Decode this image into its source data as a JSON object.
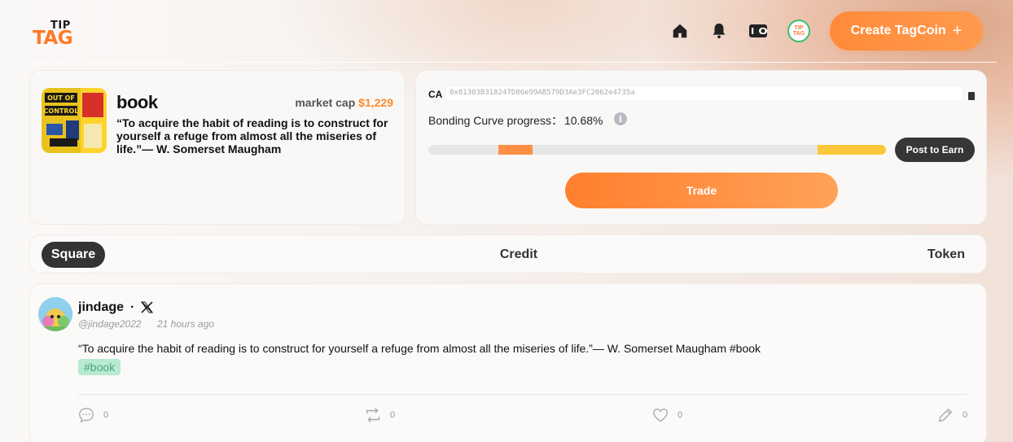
{
  "brand": {
    "logo_top": "TIP",
    "logo_bottom": "TAG"
  },
  "header": {
    "nav_icons": [
      "home-icon",
      "bell-icon",
      "wallet-icon",
      "profile-avatar"
    ],
    "avatar_text": "TIP TAG",
    "create_label": "Create TagCoin",
    "create_icon": "+"
  },
  "token": {
    "name": "book",
    "market_cap_label": "market cap",
    "market_cap_value": "$1,229",
    "description": "“To acquire the habit of reading is to construct for yourself a refuge from almost all the miseries of life.”— W. Somerset Maugham",
    "cover_text": "OUT OF CONTROL"
  },
  "contract": {
    "ca_label": "CA",
    "ca_value": "0x81303B318247D86e99AB579D3Ae3FC2062e4735a",
    "bonding_label": "Bonding Curve progress：",
    "bonding_pct": "10.68%",
    "progress": {
      "start": 0.153,
      "end": 0.228
    },
    "post_label": "Post to Earn",
    "trade_label": "Trade"
  },
  "tabs": {
    "square": "Square",
    "credit": "Credit",
    "token": "Token",
    "active": "square"
  },
  "post": {
    "username": "jindage",
    "separator": "·",
    "handle": "@jindage2022",
    "time": "21 hours ago",
    "text": "“To acquire the habit of reading is to construct for yourself a refuge from almost all the miseries of life.”— W. Somerset Maugham #book",
    "hashtag": "#book",
    "comments": "0",
    "reposts": "0",
    "likes": "0",
    "edits": "0"
  },
  "colors": {
    "accent": "#ff8a3a",
    "dark": "#333333",
    "goal": "#fcc73a",
    "tag_bg": "#b8e9d1"
  }
}
